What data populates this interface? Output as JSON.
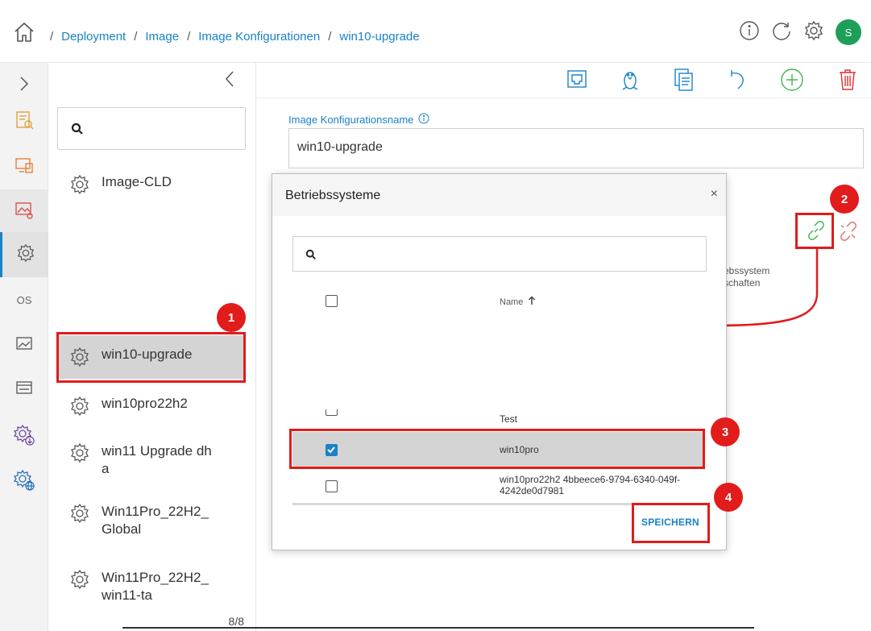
{
  "breadcrumb": {
    "items": [
      "Deployment",
      "Image",
      "Image Konfigurationen",
      "win10-upgrade"
    ],
    "separator": "/"
  },
  "header": {
    "avatar_initial": "S"
  },
  "rail": {
    "os_label": "OS"
  },
  "list": {
    "search_placeholder": "",
    "items": [
      {
        "label": "Image-CLD"
      },
      {
        "label": "win10-upgrade"
      },
      {
        "label": "win10pro22h2"
      },
      {
        "label": "win11 Upgrade dh a"
      },
      {
        "label": "Win11Pro_22H2_ Global"
      },
      {
        "label": "Win11Pro_22H2_ win11-ta"
      }
    ],
    "pager": "8/8"
  },
  "main": {
    "field_label": "Image Konfigurationsname",
    "field_value": "win10-upgrade",
    "os_section_line1": "ebssystem",
    "os_section_line2": "schaften"
  },
  "modal": {
    "title": "Betriebssysteme",
    "close": "×",
    "search_placeholder": "",
    "column_name": "Name",
    "rows": [
      {
        "name": "Test",
        "checked": false
      },
      {
        "name": "win10pro",
        "checked": true
      },
      {
        "name": "win10pro22h2 4bbeece6-9794-6340-049f-4242de0d7981",
        "checked": false
      }
    ],
    "save_label": "SPEICHERN"
  },
  "annotations": {
    "badges": [
      "1",
      "2",
      "3",
      "4"
    ],
    "color": "#e21b1b"
  },
  "colors": {
    "accent": "#1a82c8",
    "avatar": "#1e9e57",
    "add": "#3db34a",
    "delete": "#e03131"
  }
}
